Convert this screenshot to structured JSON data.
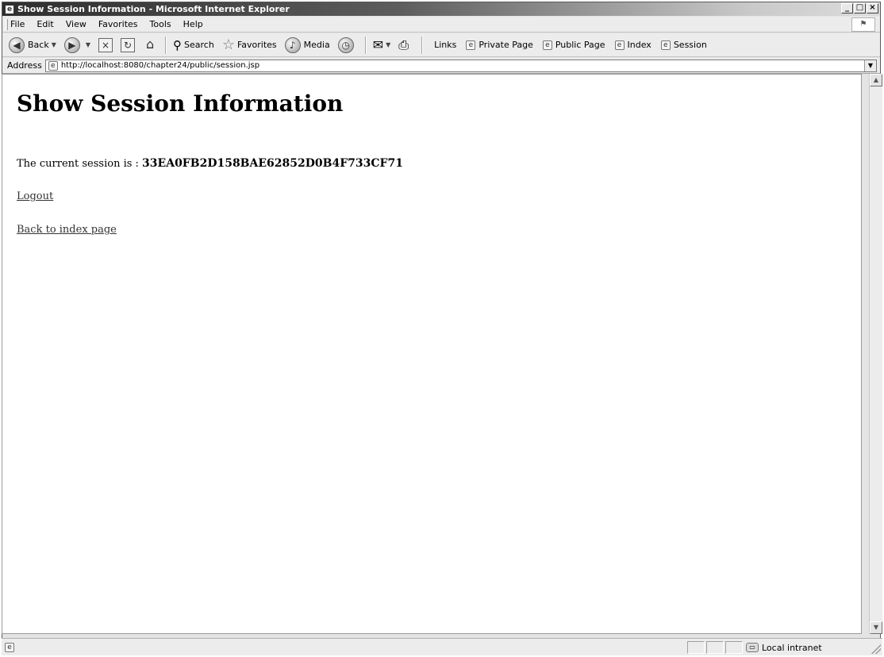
{
  "window": {
    "title": "Show Session Information - Microsoft Internet Explorer"
  },
  "menu": {
    "items": [
      "File",
      "Edit",
      "View",
      "Favorites",
      "Tools",
      "Help"
    ]
  },
  "toolbar": {
    "back_label": "Back",
    "search_label": "Search",
    "favorites_label": "Favorites",
    "media_label": "Media",
    "links_label": "Links",
    "links": [
      "Private Page",
      "Public Page",
      "Index",
      "Session"
    ]
  },
  "address": {
    "label": "Address",
    "url": "http://localhost:8080/chapter24/public/session.jsp"
  },
  "page": {
    "heading": "Show Session Information",
    "session_prefix": "The current session is : ",
    "session_id": "33EA0FB2D158BAE62852D0B4F733CF71",
    "logout_link": "Logout",
    "back_link": "Back to index page"
  },
  "status": {
    "zone": "Local intranet"
  }
}
